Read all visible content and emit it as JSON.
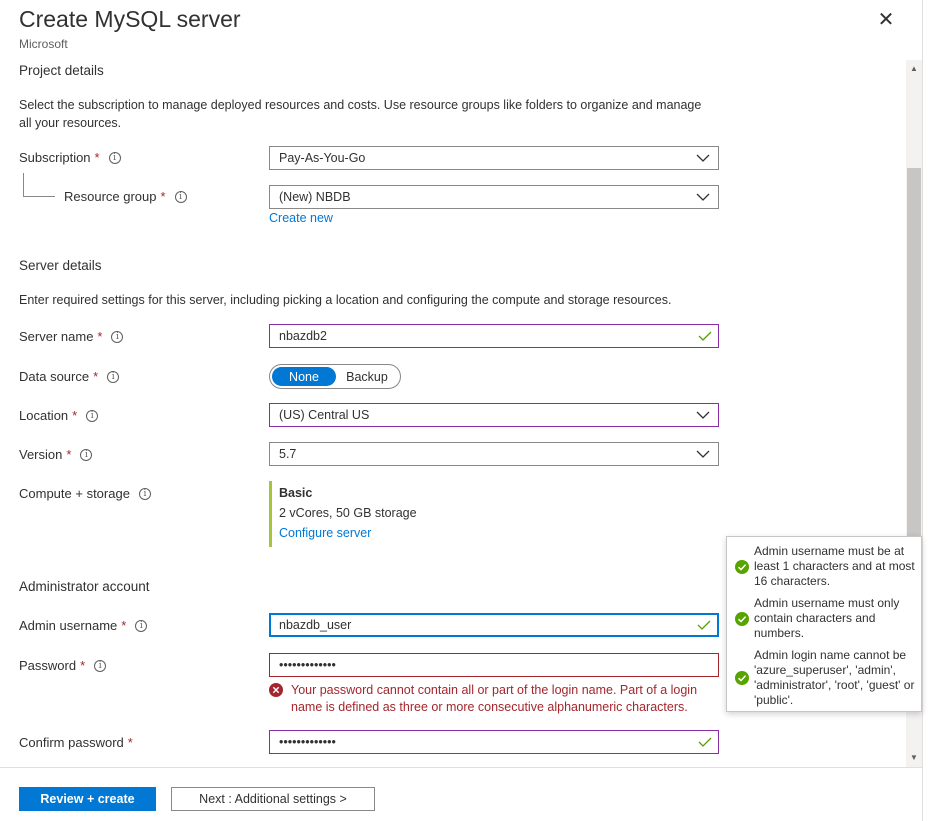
{
  "header": {
    "title": "Create MySQL server",
    "publisher": "Microsoft",
    "close_icon": "close-icon"
  },
  "project": {
    "title": "Project details",
    "description": "Select the subscription to manage deployed resources and costs. Use resource groups like folders to organize and manage all your resources.",
    "subscription": {
      "label": "Subscription",
      "value": "Pay-As-You-Go"
    },
    "resource_group": {
      "label": "Resource group",
      "value": "(New) NBDB",
      "create_new": "Create new"
    }
  },
  "server": {
    "title": "Server details",
    "description": "Enter required settings for this server, including picking a location and configuring the compute and storage resources.",
    "server_name": {
      "label": "Server name",
      "value": "nbazdb2"
    },
    "data_source": {
      "label": "Data source",
      "options": [
        "None",
        "Backup"
      ],
      "selected": "None"
    },
    "location": {
      "label": "Location",
      "value": "(US) Central US"
    },
    "version": {
      "label": "Version",
      "value": "5.7"
    },
    "compute": {
      "label": "Compute + storage",
      "tier": "Basic",
      "spec": "2 vCores, 50 GB storage",
      "configure": "Configure server"
    }
  },
  "admin": {
    "title": "Administrator account",
    "username": {
      "label": "Admin username",
      "value": "nbazdb_user"
    },
    "password": {
      "label": "Password",
      "value": "•••••••••••••",
      "error": "Your password cannot contain all or part of the login name. Part of a login name is defined as three or more consecutive alphanumeric characters."
    },
    "confirm": {
      "label": "Confirm password",
      "value": "•••••••••••••"
    }
  },
  "tooltip": {
    "rules": [
      "Admin username must be at least 1 characters and at most 16 characters.",
      "Admin username must only contain characters and numbers.",
      "Admin login name cannot be 'azure_superuser', 'admin', 'administrator', 'root', 'guest' or 'public'."
    ]
  },
  "footer": {
    "review_create": "Review + create",
    "next": "Next : Additional settings >"
  },
  "colors": {
    "accent": "#0078d4",
    "error": "#a4262c",
    "success": "#57a300",
    "focus_purple": "#8a2da5"
  },
  "req_mark": "*",
  "info_glyph": "i"
}
